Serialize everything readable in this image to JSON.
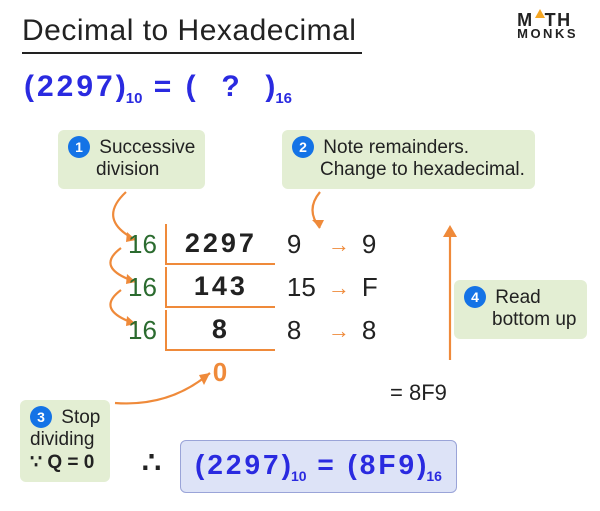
{
  "brand": {
    "line1": "MATH",
    "line2": "MONKS"
  },
  "title": "Decimal to Hexadecimal",
  "equation": {
    "open": "(",
    "value": "2297",
    "close": ")",
    "base_in": "10",
    "equals": " = ",
    "q_open": "(",
    "q": "?",
    "q_close": ")",
    "base_out": "16"
  },
  "labels": {
    "l1": {
      "num": "1",
      "line1": "Successive",
      "line2": "division"
    },
    "l2": {
      "num": "2",
      "line1": "Note remainders.",
      "line2": "Change to hexadecimal."
    },
    "l3": {
      "num": "3",
      "line1": "Stop",
      "line2": "dividing",
      "line3": "∵ Q = 0"
    },
    "l4": {
      "num": "4",
      "line1": "Read",
      "line2": "bottom up"
    }
  },
  "work": {
    "divisor": "16",
    "rows": [
      {
        "dividend": "2297",
        "rem": "9",
        "hex": "9"
      },
      {
        "dividend": "143",
        "rem": "15",
        "hex": "F"
      },
      {
        "dividend": "8",
        "rem": "8",
        "hex": "8"
      }
    ],
    "final_quotient": "0"
  },
  "result_inline": "= 8F9",
  "answer": {
    "therefore": "∴",
    "open": "(",
    "dec": "2297",
    "close": ")",
    "base_in": "10",
    "eq": " = ",
    "open2": "(",
    "hex": "8F9",
    "close2": ")",
    "base_out": "16"
  }
}
